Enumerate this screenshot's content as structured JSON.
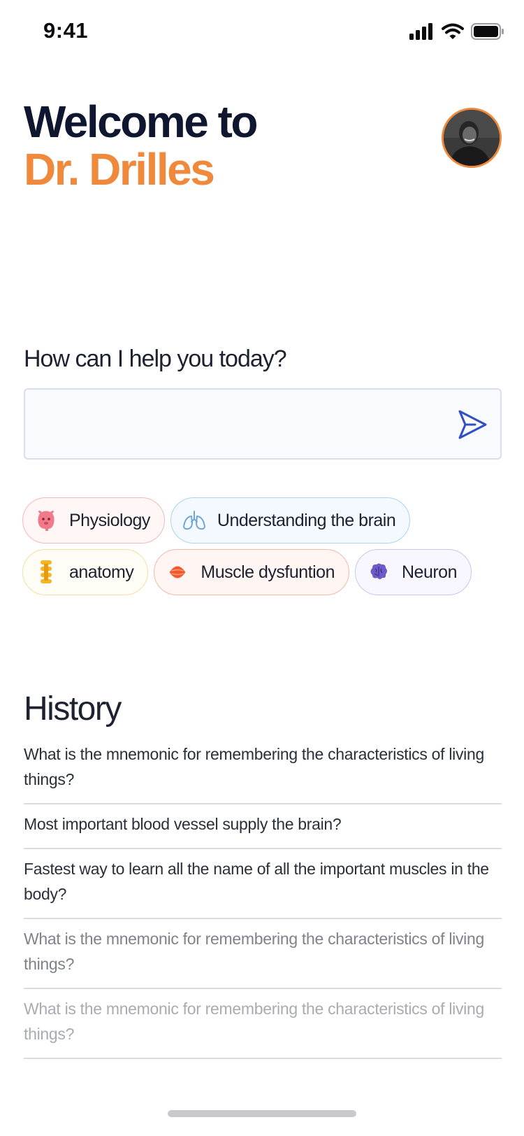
{
  "status_bar": {
    "time": "9:41"
  },
  "header": {
    "title_line1": "Welcome to",
    "title_line2": "Dr. Drilles",
    "accent_color": "#ef8a3c",
    "avatar_icon": "user-avatar"
  },
  "prompt": {
    "label": "How can I help you today?",
    "input_value": "",
    "send_icon": "send-icon"
  },
  "chips": {
    "row1": [
      {
        "label": "Physiology",
        "icon": "stomach-icon"
      },
      {
        "label": "Understanding the brain",
        "icon": "lungs-icon"
      }
    ],
    "row2": [
      {
        "label": "anatomy",
        "icon": "spine-icon"
      },
      {
        "label": "Muscle dysfuntion",
        "icon": "muscle-icon"
      },
      {
        "label": "Neuron",
        "icon": "brain-icon"
      }
    ]
  },
  "history": {
    "title": "History",
    "items": [
      {
        "text": "What is the mnemonic for remembering the characteristics of living things?",
        "color": "#2b2f3a"
      },
      {
        "text": "Most important blood vessel supply the brain?",
        "color": "#2b2f3a"
      },
      {
        "text": "Fastest way to learn all the name of all the important muscles in the body?",
        "color": "#2b2f3a"
      },
      {
        "text": "What is the mnemonic for remembering the characteristics of living things?",
        "color": "#7f828b"
      },
      {
        "text": "What is the mnemonic for remembering the characteristics of living things?",
        "color": "#a9abb2"
      }
    ]
  }
}
